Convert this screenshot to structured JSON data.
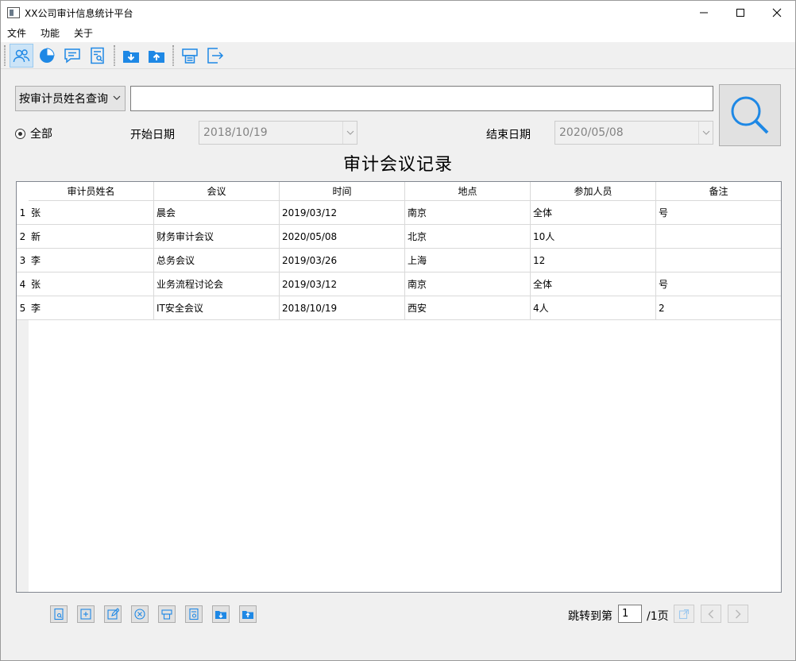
{
  "window": {
    "title": "XX公司审计信息统计平台"
  },
  "menu": [
    "文件",
    "功能",
    "关于"
  ],
  "toolbar": {
    "icons": [
      "users-icon",
      "pie-chart-icon",
      "chat-icon",
      "report-search-icon",
      "download-icon",
      "upload-icon",
      "print-icon",
      "exit-icon"
    ]
  },
  "search": {
    "mode": "按审计员姓名查询",
    "query": "",
    "radio_all": "全部",
    "start_label": "开始日期",
    "start_date": "2018/10/19",
    "end_label": "结束日期",
    "end_date": "2020/05/08"
  },
  "table": {
    "title": "审计会议记录",
    "columns": [
      "审计员姓名",
      "会议",
      "时间",
      "地点",
      "参加人员",
      "备注"
    ],
    "rows": [
      {
        "num": "1",
        "cells": [
          "张",
          "晨会",
          "2019/03/12",
          "南京",
          "全体",
          "号"
        ]
      },
      {
        "num": "2",
        "cells": [
          "新",
          "财务审计会议",
          "2020/05/08",
          "北京",
          "10人",
          ""
        ]
      },
      {
        "num": "3",
        "cells": [
          "李",
          "总务会议",
          "2019/03/26",
          "上海",
          "12",
          ""
        ]
      },
      {
        "num": "4",
        "cells": [
          "张",
          "业务流程讨论会",
          "2019/03/12",
          "南京",
          "全体",
          "号"
        ]
      },
      {
        "num": "5",
        "cells": [
          "李",
          "IT安全会议",
          "2018/10/19",
          "西安",
          "4人",
          "2"
        ]
      }
    ]
  },
  "pager": {
    "goto_label": "跳转到第",
    "page": "1",
    "total_label": "/1页"
  },
  "colors": {
    "accent": "#1e88e5",
    "border": "#d9d9d9"
  }
}
